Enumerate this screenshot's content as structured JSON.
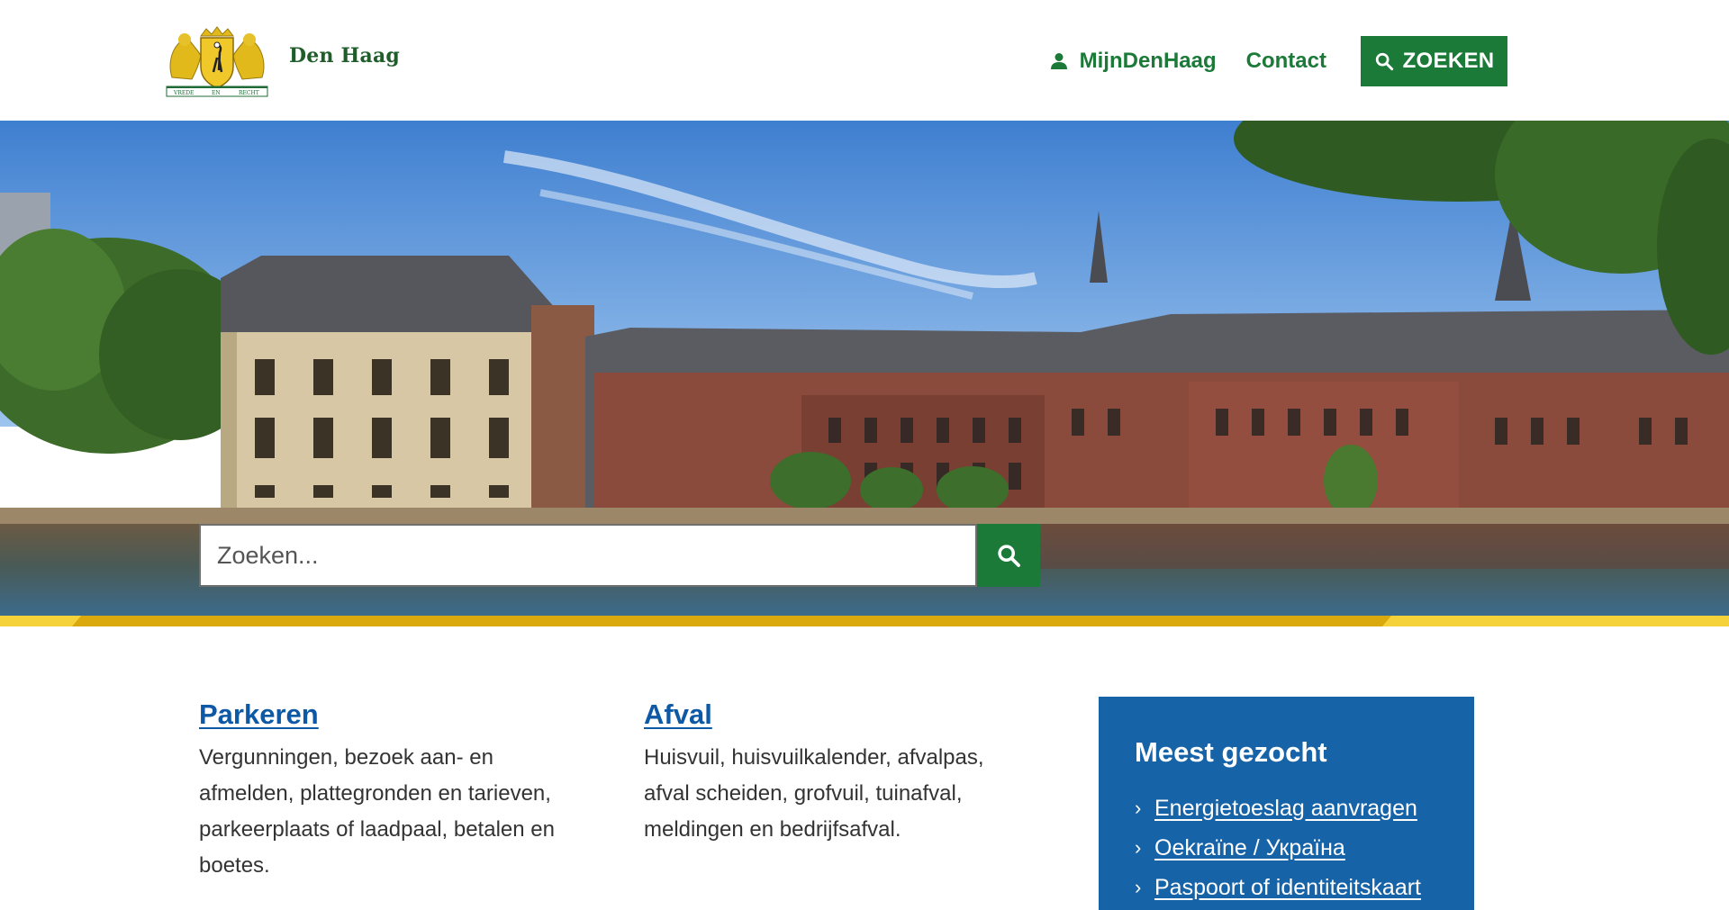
{
  "header": {
    "brand": "Den Haag",
    "logo_motto": [
      "VREDE",
      "EN",
      "RECHT"
    ],
    "nav": {
      "mijn_label": "MijnDenHaag",
      "contact_label": "Contact",
      "search_label": "ZOEKEN"
    }
  },
  "hero": {
    "search_placeholder": "Zoeken..."
  },
  "cards": [
    {
      "title": "Parkeren",
      "text": "Vergunningen, bezoek aan- en afmelden, plattegronden en tarieven, parkeerplaats of laadpaal, betalen en boetes."
    },
    {
      "title": "Afval",
      "text": "Huisvuil, huisvuilkalender, afvalpas, afval scheiden, grofvuil, tuinafval, meldingen en bedrijfsafval."
    }
  ],
  "most_searched": {
    "title": "Meest gezocht",
    "items": [
      {
        "label": "Energietoeslag aanvragen"
      },
      {
        "label": "Oekraïne / Україна"
      },
      {
        "label": "Paspoort of identiteitskaart"
      }
    ]
  },
  "colors": {
    "green": "#1b7a38",
    "blue": "#1763a8",
    "link_blue": "#0d59a5",
    "yellow": "#f2c31a"
  }
}
